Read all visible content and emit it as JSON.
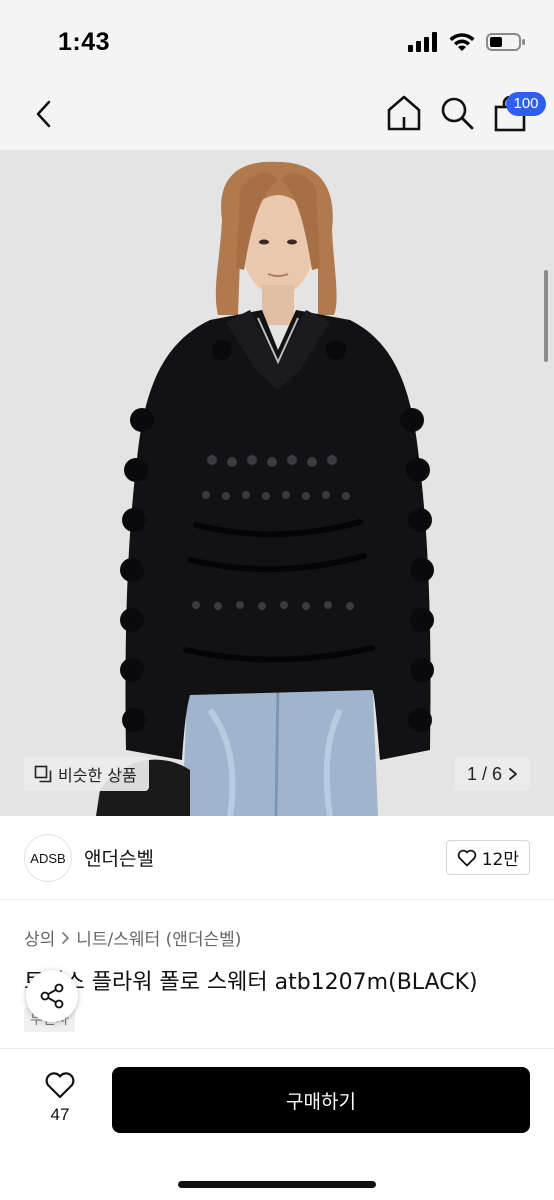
{
  "status_bar": {
    "time": "1:43"
  },
  "nav": {
    "cart_count": "100"
  },
  "hero": {
    "similar_label": "비슷한 상품",
    "page_indicator": "1 / 6"
  },
  "brand": {
    "logo_text": "ADSB",
    "name": "앤더슨벨",
    "likes": "12만"
  },
  "breadcrumb": [
    "상의",
    "니트/스웨터 (앤더슨벨)"
  ],
  "product": {
    "title": "트리스 플라워 폴로 스웨터 atb1207m(BLACK)",
    "tag": "무신사"
  },
  "bottom": {
    "wish_count": "47",
    "buy_label": "구매하기"
  },
  "colors": {
    "accent": "#2f5ff0",
    "button": "#000000"
  }
}
